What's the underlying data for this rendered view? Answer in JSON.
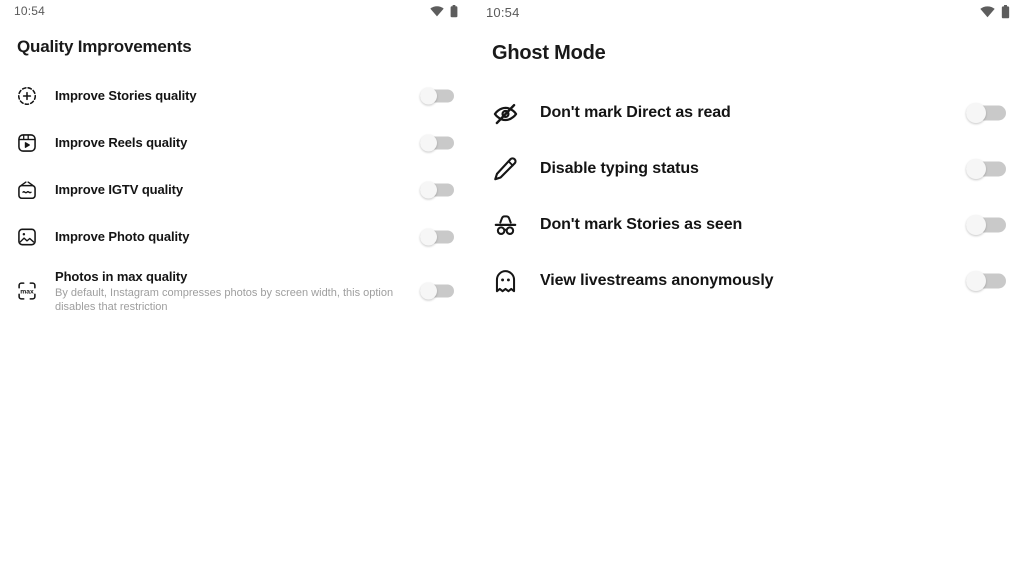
{
  "screens": [
    {
      "id": "quality-improvements",
      "status_bar": {
        "time": "10:54",
        "wifi": "wifi-icon",
        "battery": "battery-icon"
      },
      "title": "Quality Improvements",
      "rows": [
        {
          "icon": "add-to-story-icon",
          "label": "Improve Stories quality",
          "subtitle": "",
          "toggle_state": "off"
        },
        {
          "icon": "reels-icon",
          "label": "Improve Reels quality",
          "subtitle": "",
          "toggle_state": "off"
        },
        {
          "icon": "igtv-icon",
          "label": "Improve IGTV quality",
          "subtitle": "",
          "toggle_state": "off"
        },
        {
          "icon": "photo-icon",
          "label": "Improve Photo quality",
          "subtitle": "",
          "toggle_state": "off"
        },
        {
          "icon": "max-quality-icon",
          "label": "Photos in max quality",
          "subtitle": "By default, Instagram compresses photos by screen width, this option disables that restriction",
          "toggle_state": "off"
        }
      ]
    },
    {
      "id": "ghost-mode",
      "status_bar": {
        "time": "10:54",
        "wifi": "wifi-icon",
        "battery": "battery-icon"
      },
      "title": "Ghost Mode",
      "rows": [
        {
          "icon": "eye-off-icon",
          "label": "Don't mark Direct as read",
          "subtitle": "",
          "toggle_state": "off"
        },
        {
          "icon": "pencil-icon",
          "label": "Disable typing status",
          "subtitle": "",
          "toggle_state": "off"
        },
        {
          "icon": "incognito-icon",
          "label": "Don't mark Stories as seen",
          "subtitle": "",
          "toggle_state": "off"
        },
        {
          "icon": "ghost-icon",
          "label": "View livestreams anonymously",
          "subtitle": "",
          "toggle_state": "off"
        }
      ]
    }
  ],
  "colors": {
    "background": "#ffffff",
    "title_text": "#1a1a1a",
    "label_text": "#141414",
    "subtitle_text": "#9e9e9e",
    "status_text": "#5a5a5a",
    "toggle_track_off": "#c9c9c9",
    "toggle_knob_off": "#f6f6f6",
    "icon_color": "#161616"
  }
}
